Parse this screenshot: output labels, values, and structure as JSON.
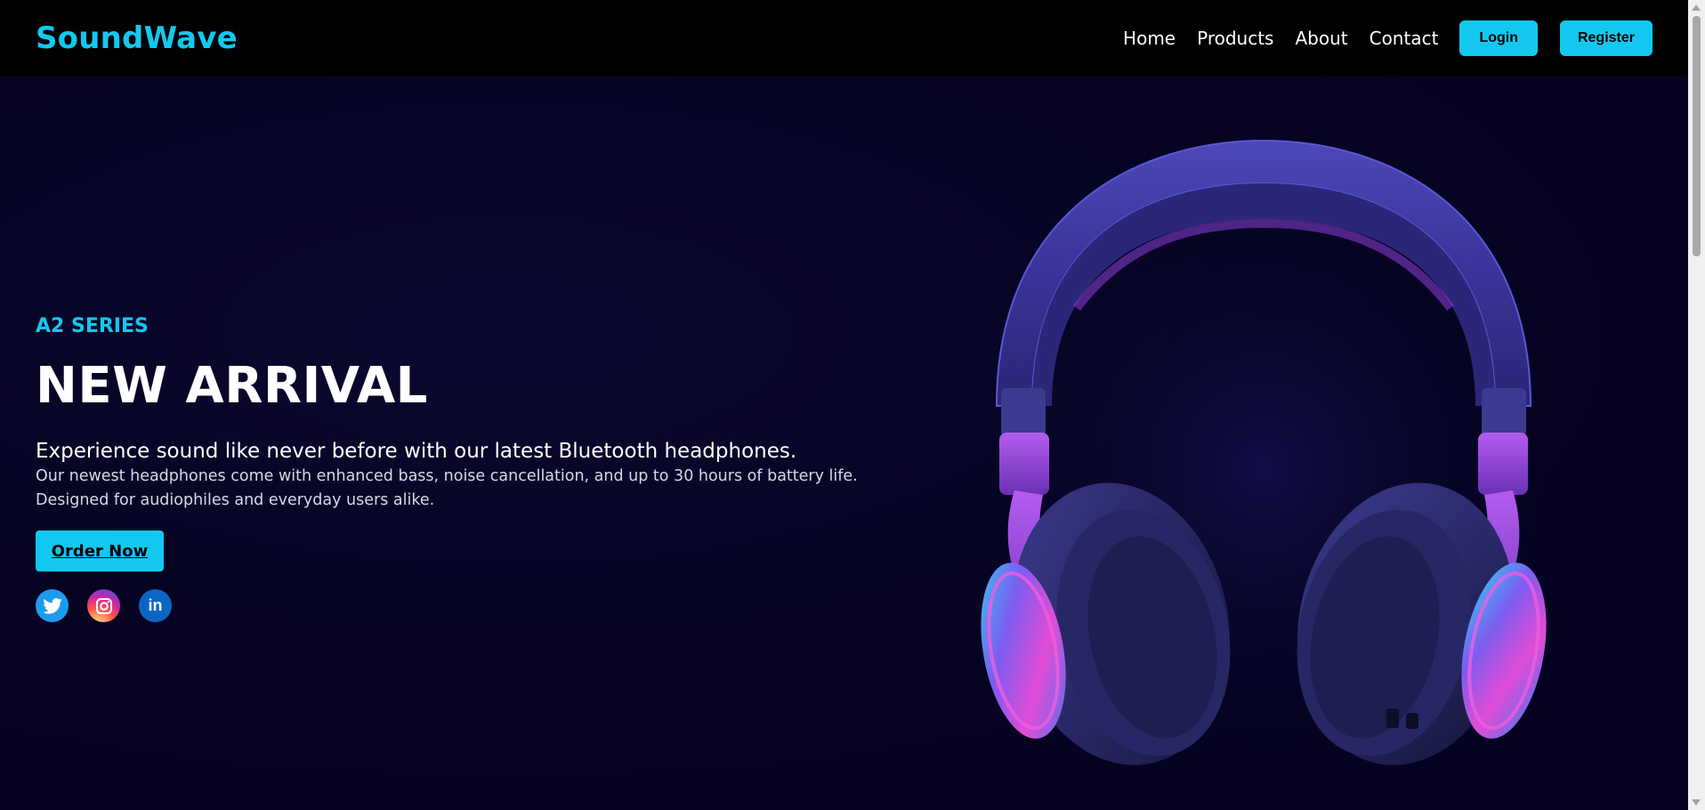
{
  "nav": {
    "brand": "SoundWave",
    "links": [
      "Home",
      "Products",
      "About",
      "Contact"
    ],
    "login_label": "Login",
    "register_label": "Register"
  },
  "hero": {
    "series": "A2 SERIES",
    "headline": "NEW ARRIVAL",
    "tagline": "Experience sound like never before with our latest Bluetooth headphones.",
    "description_line1": "Our newest headphones come with enhanced bass, noise cancellation, and up to 30 hours of battery life.",
    "description_line2": "Designed for audiophiles and everyday users alike.",
    "cta_label": "Order Now",
    "socials": [
      "twitter-icon",
      "instagram-icon",
      "linkedin-icon"
    ],
    "linkedin_glyph": "in"
  },
  "colors": {
    "accent": "#12c8ef",
    "navbar_bg": "#000000",
    "hero_bg": "#060422"
  }
}
